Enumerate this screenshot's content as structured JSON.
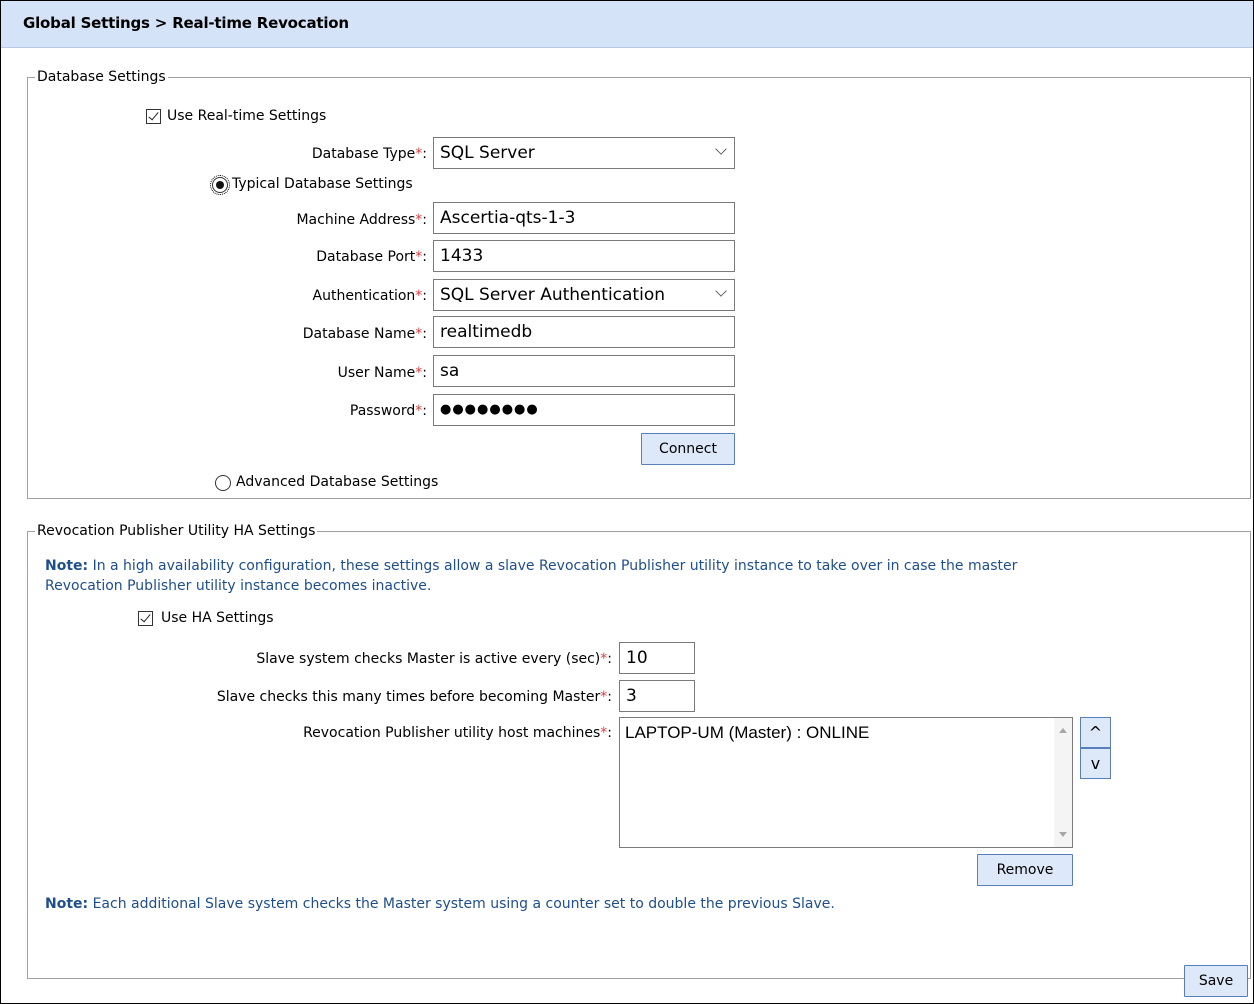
{
  "header": {
    "title": "Global Settings > Real-time Revocation"
  },
  "database_settings": {
    "legend": "Database Settings",
    "use_realtime_label": "Use Real-time Settings",
    "use_realtime_checked": true,
    "database_type": {
      "label": "Database Type",
      "value": "SQL Server"
    },
    "typical_label": "Typical Database Settings",
    "typical_selected": true,
    "machine_address": {
      "label": "Machine Address",
      "value": "Ascertia-qts-1-3"
    },
    "database_port": {
      "label": "Database Port",
      "value": "1433"
    },
    "authentication": {
      "label": "Authentication",
      "value": "SQL Server Authentication"
    },
    "database_name": {
      "label": "Database Name",
      "value": "realtimedb"
    },
    "user_name": {
      "label": "User Name",
      "value": "sa"
    },
    "password": {
      "label": "Password",
      "value": "●●●●●●●●"
    },
    "connect_label": "Connect",
    "advanced_label": "Advanced Database Settings",
    "advanced_selected": false
  },
  "ha_settings": {
    "legend": "Revocation Publisher Utility HA Settings",
    "note_prefix": "Note:",
    "note_text": " In a high availability configuration, these settings allow a slave Revocation Publisher utility instance to take over in case the master Revocation Publisher utility instance becomes inactive.",
    "use_ha_label": "Use HA Settings",
    "use_ha_checked": true,
    "check_interval": {
      "label": "Slave system checks Master is active every (sec)",
      "value": "10"
    },
    "check_count": {
      "label": "Slave checks this many times before becoming Master",
      "value": "3"
    },
    "hosts": {
      "label": "Revocation Publisher utility host machines",
      "items": [
        "LAPTOP-UM (Master) : ONLINE"
      ]
    },
    "move_up_label": "^",
    "move_down_label": "v",
    "remove_label": "Remove",
    "note2_prefix": "Note:",
    "note2_text": "  Each additional Slave system checks the Master system using a counter set to double the previous Slave."
  },
  "footer": {
    "save_label": "Save"
  },
  "required_marker": "*"
}
